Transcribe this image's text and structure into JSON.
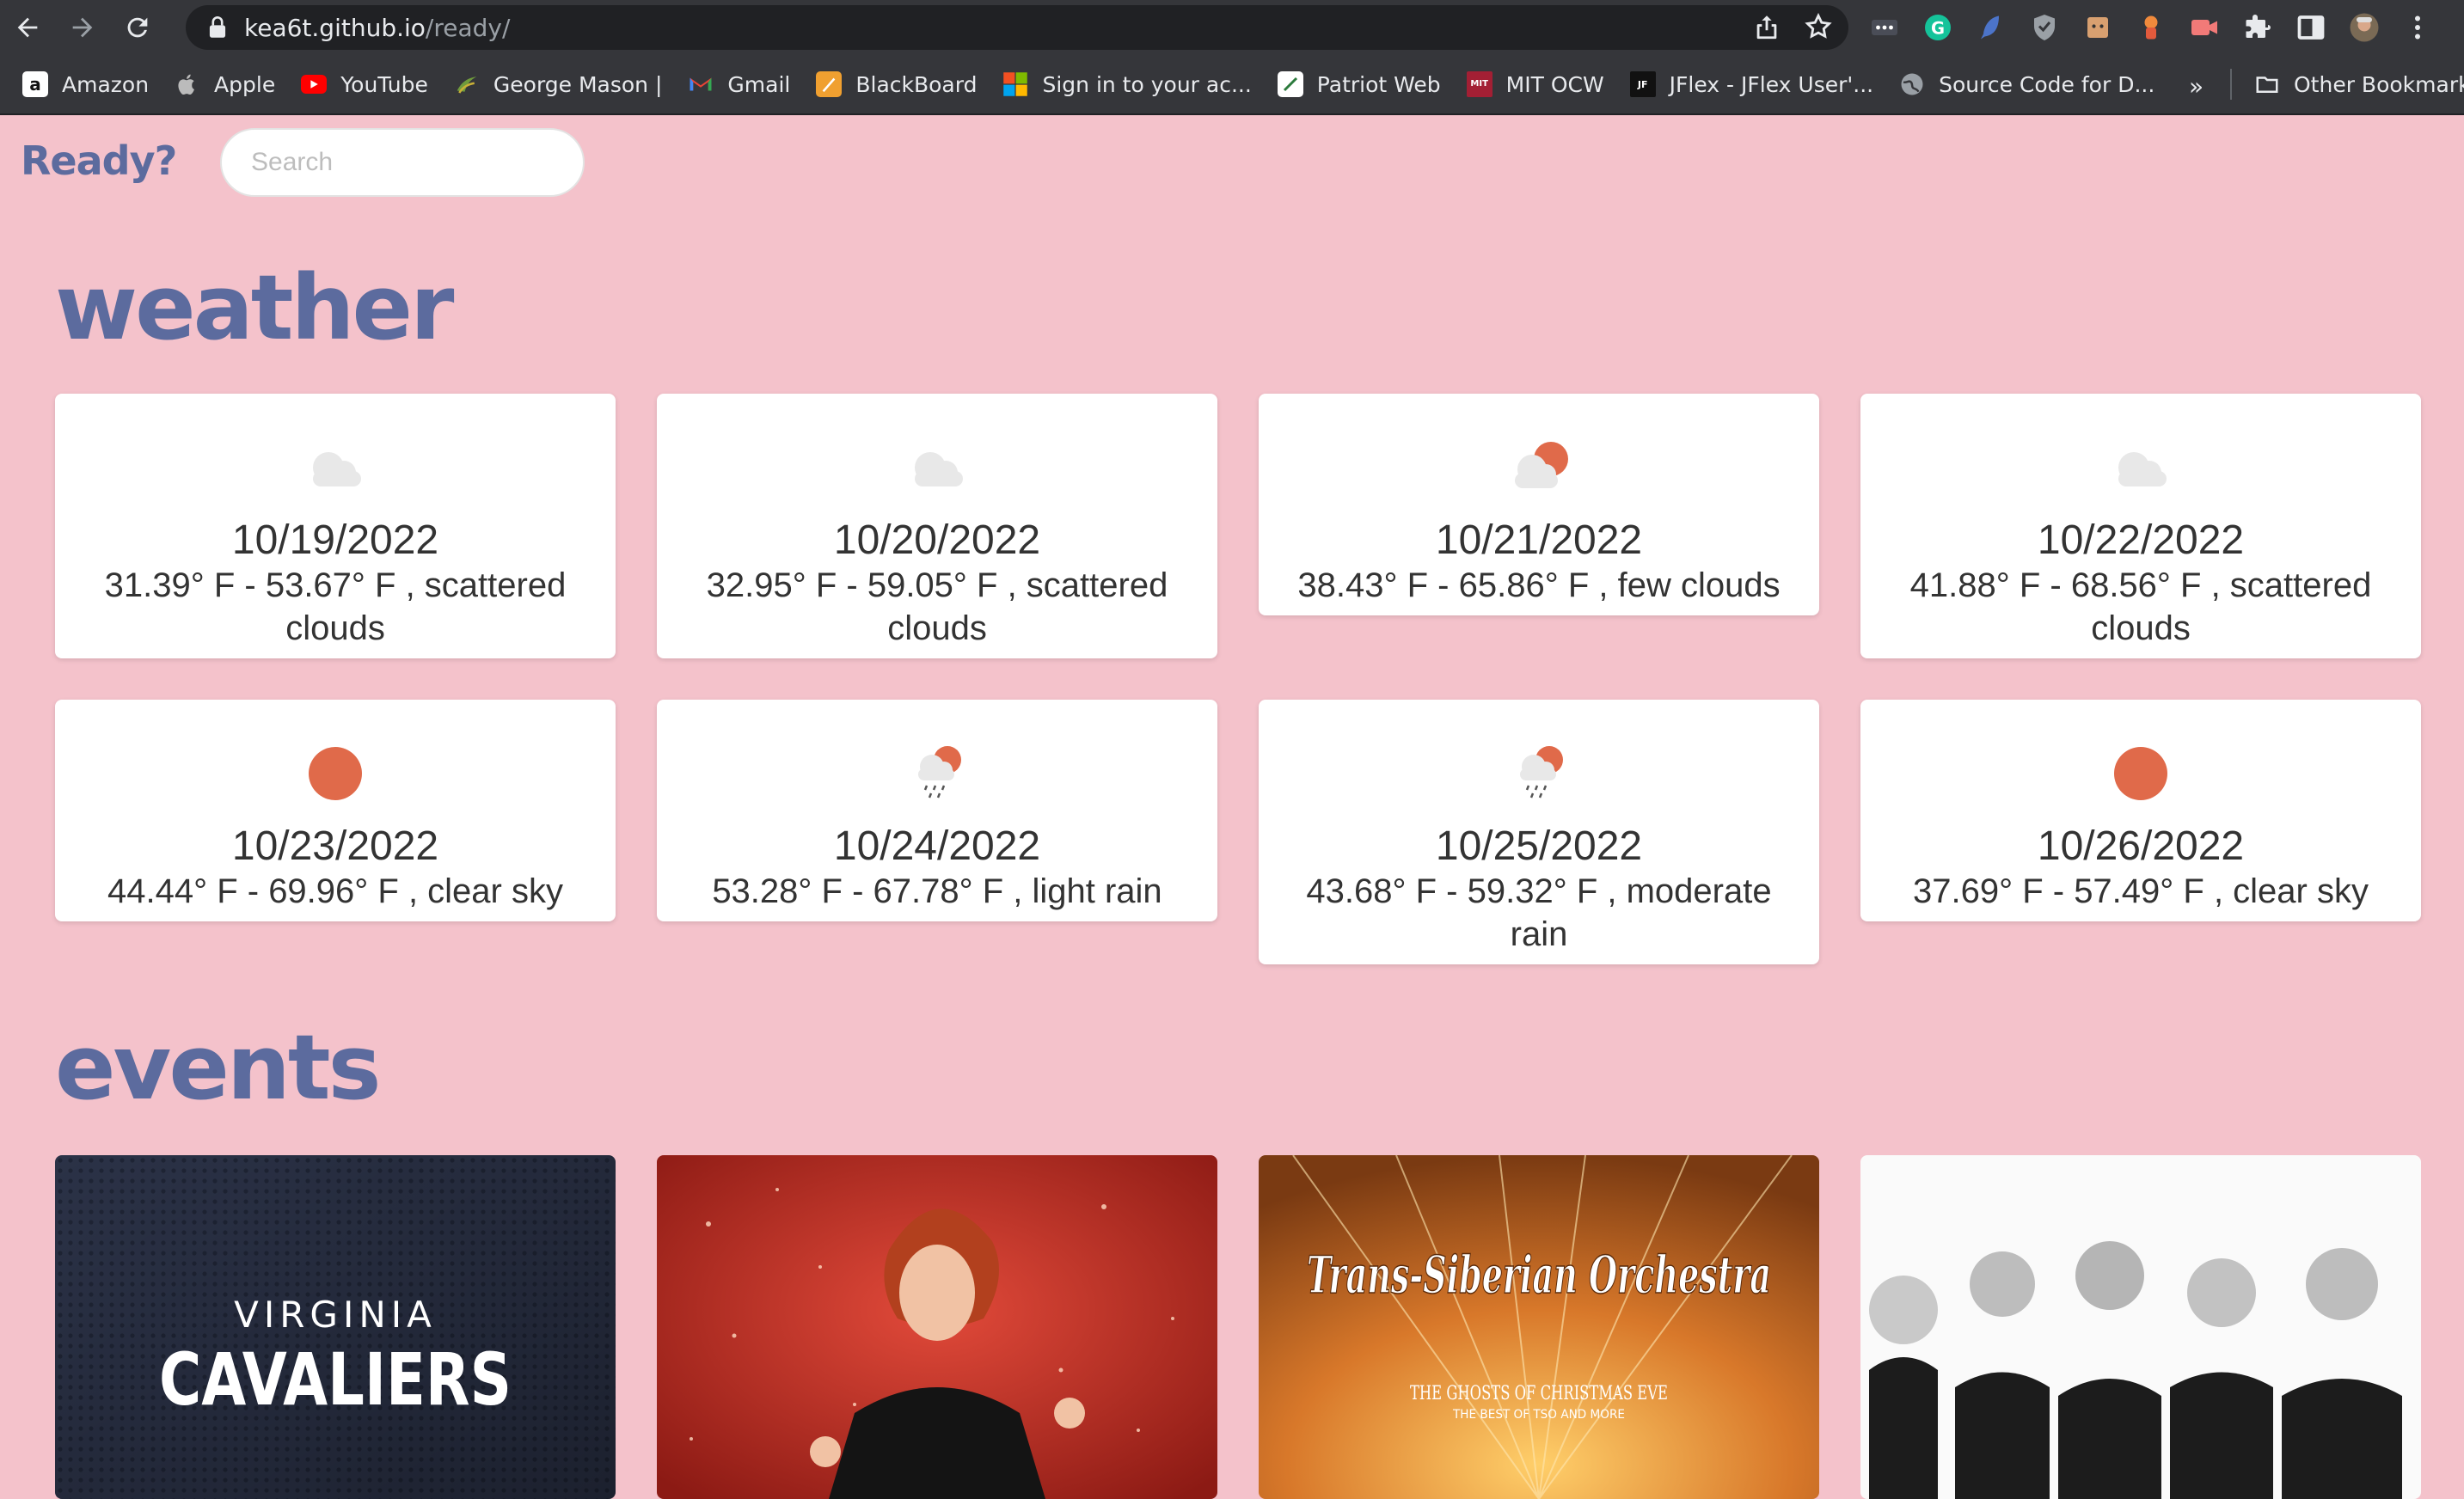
{
  "browser": {
    "url_host": "kea6t.github.io",
    "url_path": "/ready/",
    "bookmarks": [
      {
        "label": "Amazon",
        "icon": "amazon-icon"
      },
      {
        "label": "Apple",
        "icon": "apple-icon"
      },
      {
        "label": "YouTube",
        "icon": "youtube-icon"
      },
      {
        "label": "George Mason |",
        "icon": "gmu-icon"
      },
      {
        "label": "Gmail",
        "icon": "gmail-icon"
      },
      {
        "label": "BlackBoard",
        "icon": "blackboard-icon"
      },
      {
        "label": "Sign in to your ac...",
        "icon": "microsoft-icon"
      },
      {
        "label": "Patriot Web",
        "icon": "patriot-web-icon"
      },
      {
        "label": "MIT OCW",
        "icon": "mit-ocw-icon"
      },
      {
        "label": "JFlex - JFlex User'...",
        "icon": "jflex-icon"
      },
      {
        "label": "Source Code for D...",
        "icon": "globe-icon"
      }
    ],
    "more_label": "»",
    "other_bookmarks": "Other Bookmarks"
  },
  "header": {
    "brand": "Ready?",
    "search_placeholder": "Search"
  },
  "weather": {
    "title": "weather",
    "days": [
      {
        "date": "10/19/2022",
        "desc": "31.39° F - 53.67° F , scattered clouds",
        "icon": "cloud-icon"
      },
      {
        "date": "10/20/2022",
        "desc": "32.95° F - 59.05° F , scattered clouds",
        "icon": "cloud-icon"
      },
      {
        "date": "10/21/2022",
        "desc": "38.43° F - 65.86° F , few clouds",
        "icon": "sun-cloud-icon"
      },
      {
        "date": "10/22/2022",
        "desc": "41.88° F - 68.56° F , scattered clouds",
        "icon": "cloud-icon"
      },
      {
        "date": "10/23/2022",
        "desc": "44.44° F - 69.96° F , clear sky",
        "icon": "sun-icon"
      },
      {
        "date": "10/24/2022",
        "desc": "53.28° F - 67.78° F , light rain",
        "icon": "rain-icon"
      },
      {
        "date": "10/25/2022",
        "desc": "43.68° F - 59.32° F , moderate rain",
        "icon": "rain-icon"
      },
      {
        "date": "10/26/2022",
        "desc": "37.69° F - 57.49° F , clear sky",
        "icon": "sun-icon"
      }
    ]
  },
  "events": {
    "title": "events",
    "items": [
      {
        "line1": "VIRGINIA",
        "line2": "CAVALIERS"
      },
      {
        "line1": "",
        "line2": ""
      },
      {
        "line1": "Trans-Siberian Orchestra",
        "line2": "THE GHOSTS OF CHRISTMAS EVE",
        "line3": "THE BEST OF TSO AND MORE"
      },
      {
        "line1": "",
        "line2": ""
      }
    ]
  },
  "colors": {
    "page_bg": "#f4c2cb",
    "accent": "#5c6b9e",
    "sun": "#e06a4a",
    "cloud": "#e8e8e8"
  }
}
